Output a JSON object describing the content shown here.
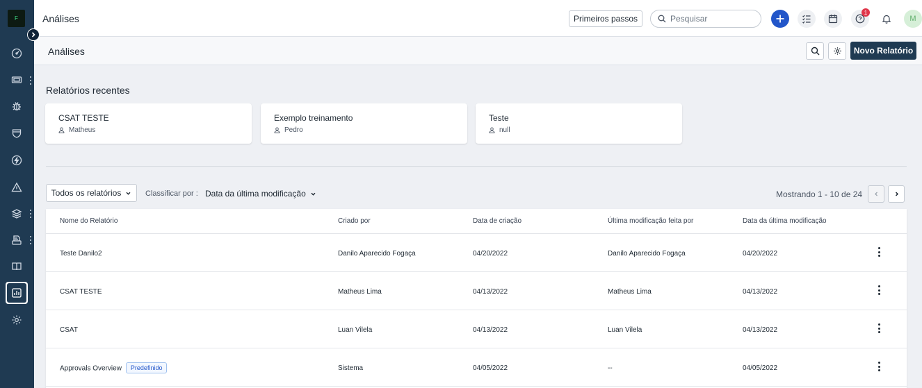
{
  "sidebar": {
    "logo_text": "F",
    "items": [
      {
        "name": "dashboard-icon"
      },
      {
        "name": "tickets-icon"
      },
      {
        "name": "bug-icon"
      },
      {
        "name": "shield-icon"
      },
      {
        "name": "lightning-icon"
      },
      {
        "name": "alert-icon"
      },
      {
        "name": "layers-icon"
      },
      {
        "name": "printer-icon"
      },
      {
        "name": "book-icon"
      },
      {
        "name": "analytics-icon",
        "active": true
      },
      {
        "name": "gear-icon"
      }
    ]
  },
  "topbar": {
    "title": "Análises",
    "primeiros_passos": "Primeiros passos",
    "search_placeholder": "Pesquisar",
    "help_badge": "1",
    "avatar_initial": "M"
  },
  "page_header": {
    "title": "Análises",
    "new_report_label": "Novo Relatório"
  },
  "recent": {
    "title": "Relatórios recentes",
    "cards": [
      {
        "title": "CSAT TESTE",
        "user": "Matheus"
      },
      {
        "title": "Exemplo treinamento",
        "user": "Pedro"
      },
      {
        "title": "Teste",
        "user": "null"
      }
    ]
  },
  "filters": {
    "all_reports": "Todos os relatórios",
    "sort_label": "Classificar por :",
    "sort_value": "Data da última modificação",
    "showing": "Mostrando 1 - 10 de 24"
  },
  "table": {
    "headers": [
      "Nome do Relatório",
      "Criado por",
      "Data de criação",
      "Última modificação feita por",
      "Data da última modificação"
    ],
    "rows": [
      {
        "name": "Teste Danilo2",
        "tag": "",
        "created_by": "Danilo Aparecido Fogaça",
        "created_date": "04/20/2022",
        "modified_by": "Danilo Aparecido Fogaça",
        "modified_date": "04/20/2022"
      },
      {
        "name": "CSAT TESTE",
        "tag": "",
        "created_by": "Matheus Lima",
        "created_date": "04/13/2022",
        "modified_by": "Matheus Lima",
        "modified_date": "04/13/2022"
      },
      {
        "name": "CSAT",
        "tag": "",
        "created_by": "Luan Vilela",
        "created_date": "04/13/2022",
        "modified_by": "Luan Vilela",
        "modified_date": "04/13/2022"
      },
      {
        "name": "Approvals Overview",
        "tag": "Predefinido",
        "created_by": "Sistema",
        "created_date": "04/05/2022",
        "modified_by": "--",
        "modified_date": "04/05/2022"
      }
    ]
  },
  "colors": {
    "sidebar": "#1f3a52",
    "primary_button": "#1f3a52",
    "accent_blue": "#2256c9",
    "badge_red": "#e0364a"
  }
}
